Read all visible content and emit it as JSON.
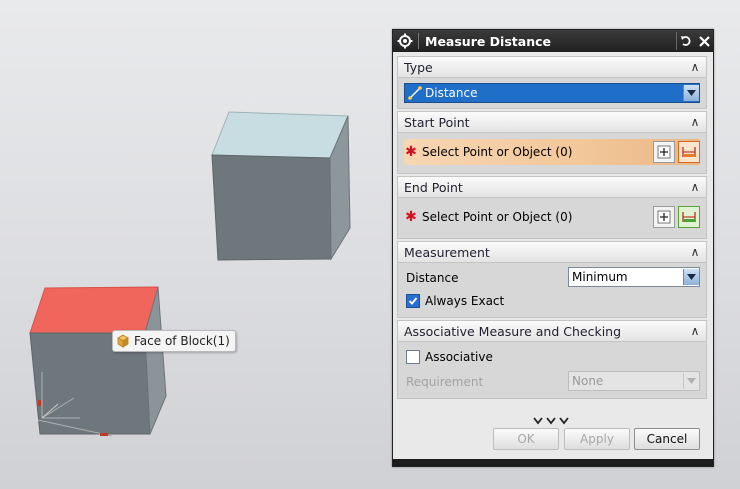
{
  "tooltip": {
    "text": "Face of Block(1)"
  },
  "dialog": {
    "title": "Measure Distance",
    "sections": {
      "type": {
        "header": "Type",
        "value": "Distance"
      },
      "start_point": {
        "header": "Start Point",
        "select_text": "Select Point or Object (0)"
      },
      "end_point": {
        "header": "End Point",
        "select_text": "Select Point or Object (0)"
      },
      "measurement": {
        "header": "Measurement",
        "distance_label": "Distance",
        "distance_value": "Minimum",
        "always_exact_label": "Always Exact",
        "always_exact_checked": true
      },
      "associative": {
        "header": "Associative Measure and Checking",
        "associative_label": "Associative",
        "associative_checked": false,
        "requirement_label": "Requirement",
        "requirement_value": "None"
      }
    },
    "buttons": {
      "ok": "OK",
      "apply": "Apply",
      "cancel": "Cancel"
    }
  },
  "colors": {
    "selected_face": "#f0655c",
    "active_select_row": "#f2c79a",
    "dropdown_selected": "#1f6fc8"
  }
}
